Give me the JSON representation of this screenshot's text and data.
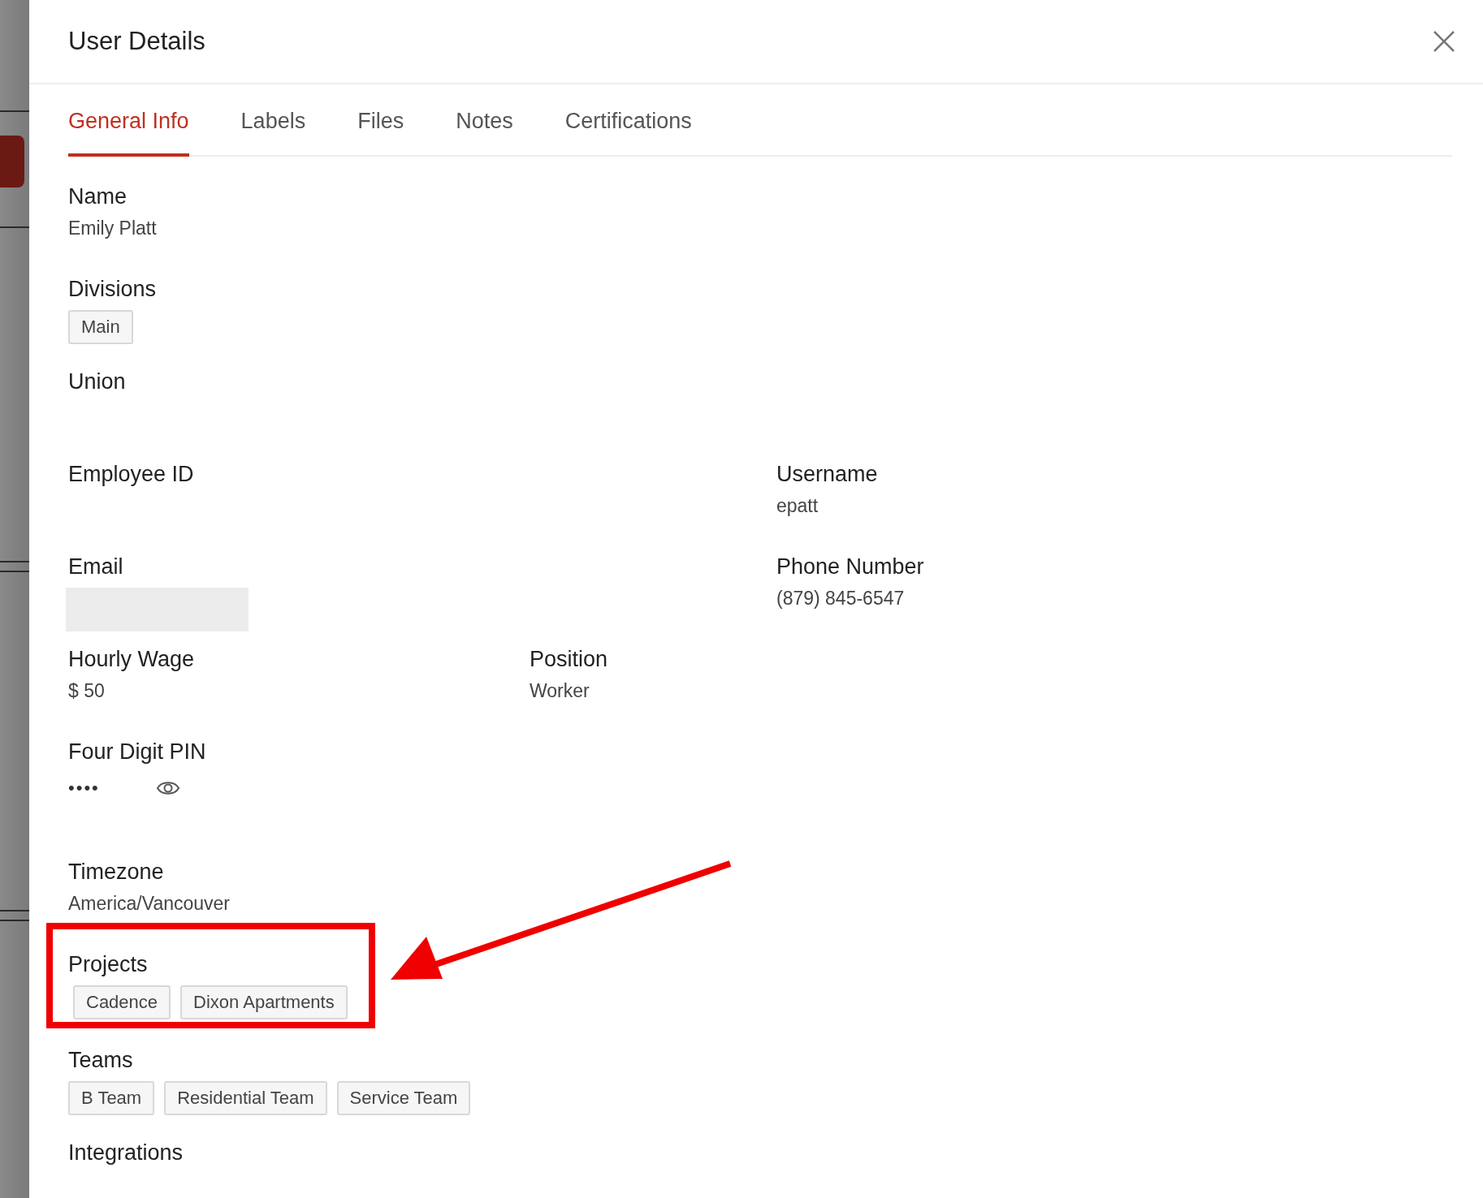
{
  "dialog": {
    "title": "User Details"
  },
  "tabs": [
    {
      "label": "General Info",
      "selected": true
    },
    {
      "label": "Labels",
      "selected": false
    },
    {
      "label": "Files",
      "selected": false
    },
    {
      "label": "Notes",
      "selected": false
    },
    {
      "label": "Certifications",
      "selected": false
    }
  ],
  "rows": [
    {
      "left": {
        "label": "Name",
        "kind": "text",
        "value": "Emily Platt"
      }
    },
    {
      "left": {
        "label": "Divisions",
        "kind": "chips",
        "chips": [
          "Main"
        ]
      }
    },
    {
      "left": {
        "label": "Union",
        "kind": "empty"
      }
    },
    {
      "left": {
        "label": "Employee ID",
        "kind": "empty"
      },
      "right": {
        "label": "Username",
        "kind": "text",
        "value": "epatt"
      }
    },
    {
      "left": {
        "label": "Email",
        "kind": "redacted"
      },
      "right": {
        "label": "Phone Number",
        "kind": "text",
        "value": "(879) 845-6547"
      }
    },
    {
      "left": {
        "label": "Hourly Wage",
        "kind": "text",
        "value": "$ 50"
      },
      "center": {
        "label": "Position",
        "kind": "text",
        "value": "Worker"
      }
    },
    {
      "left": {
        "label": "Four Digit PIN",
        "kind": "pin",
        "value": "••••"
      }
    },
    {
      "left": {
        "label": "Timezone",
        "kind": "text",
        "value": "America/Vancouver"
      }
    },
    {
      "left": {
        "label": "Projects",
        "kind": "chips",
        "chips": [
          "Cadence",
          "Dixon Apartments"
        ],
        "highlighted": true
      }
    },
    {
      "left": {
        "label": "Teams",
        "kind": "chips",
        "chips": [
          "B Team",
          "Residential Team",
          "Service Team"
        ]
      }
    },
    {
      "left": {
        "label": "Integrations",
        "kind": "empty"
      }
    }
  ]
}
